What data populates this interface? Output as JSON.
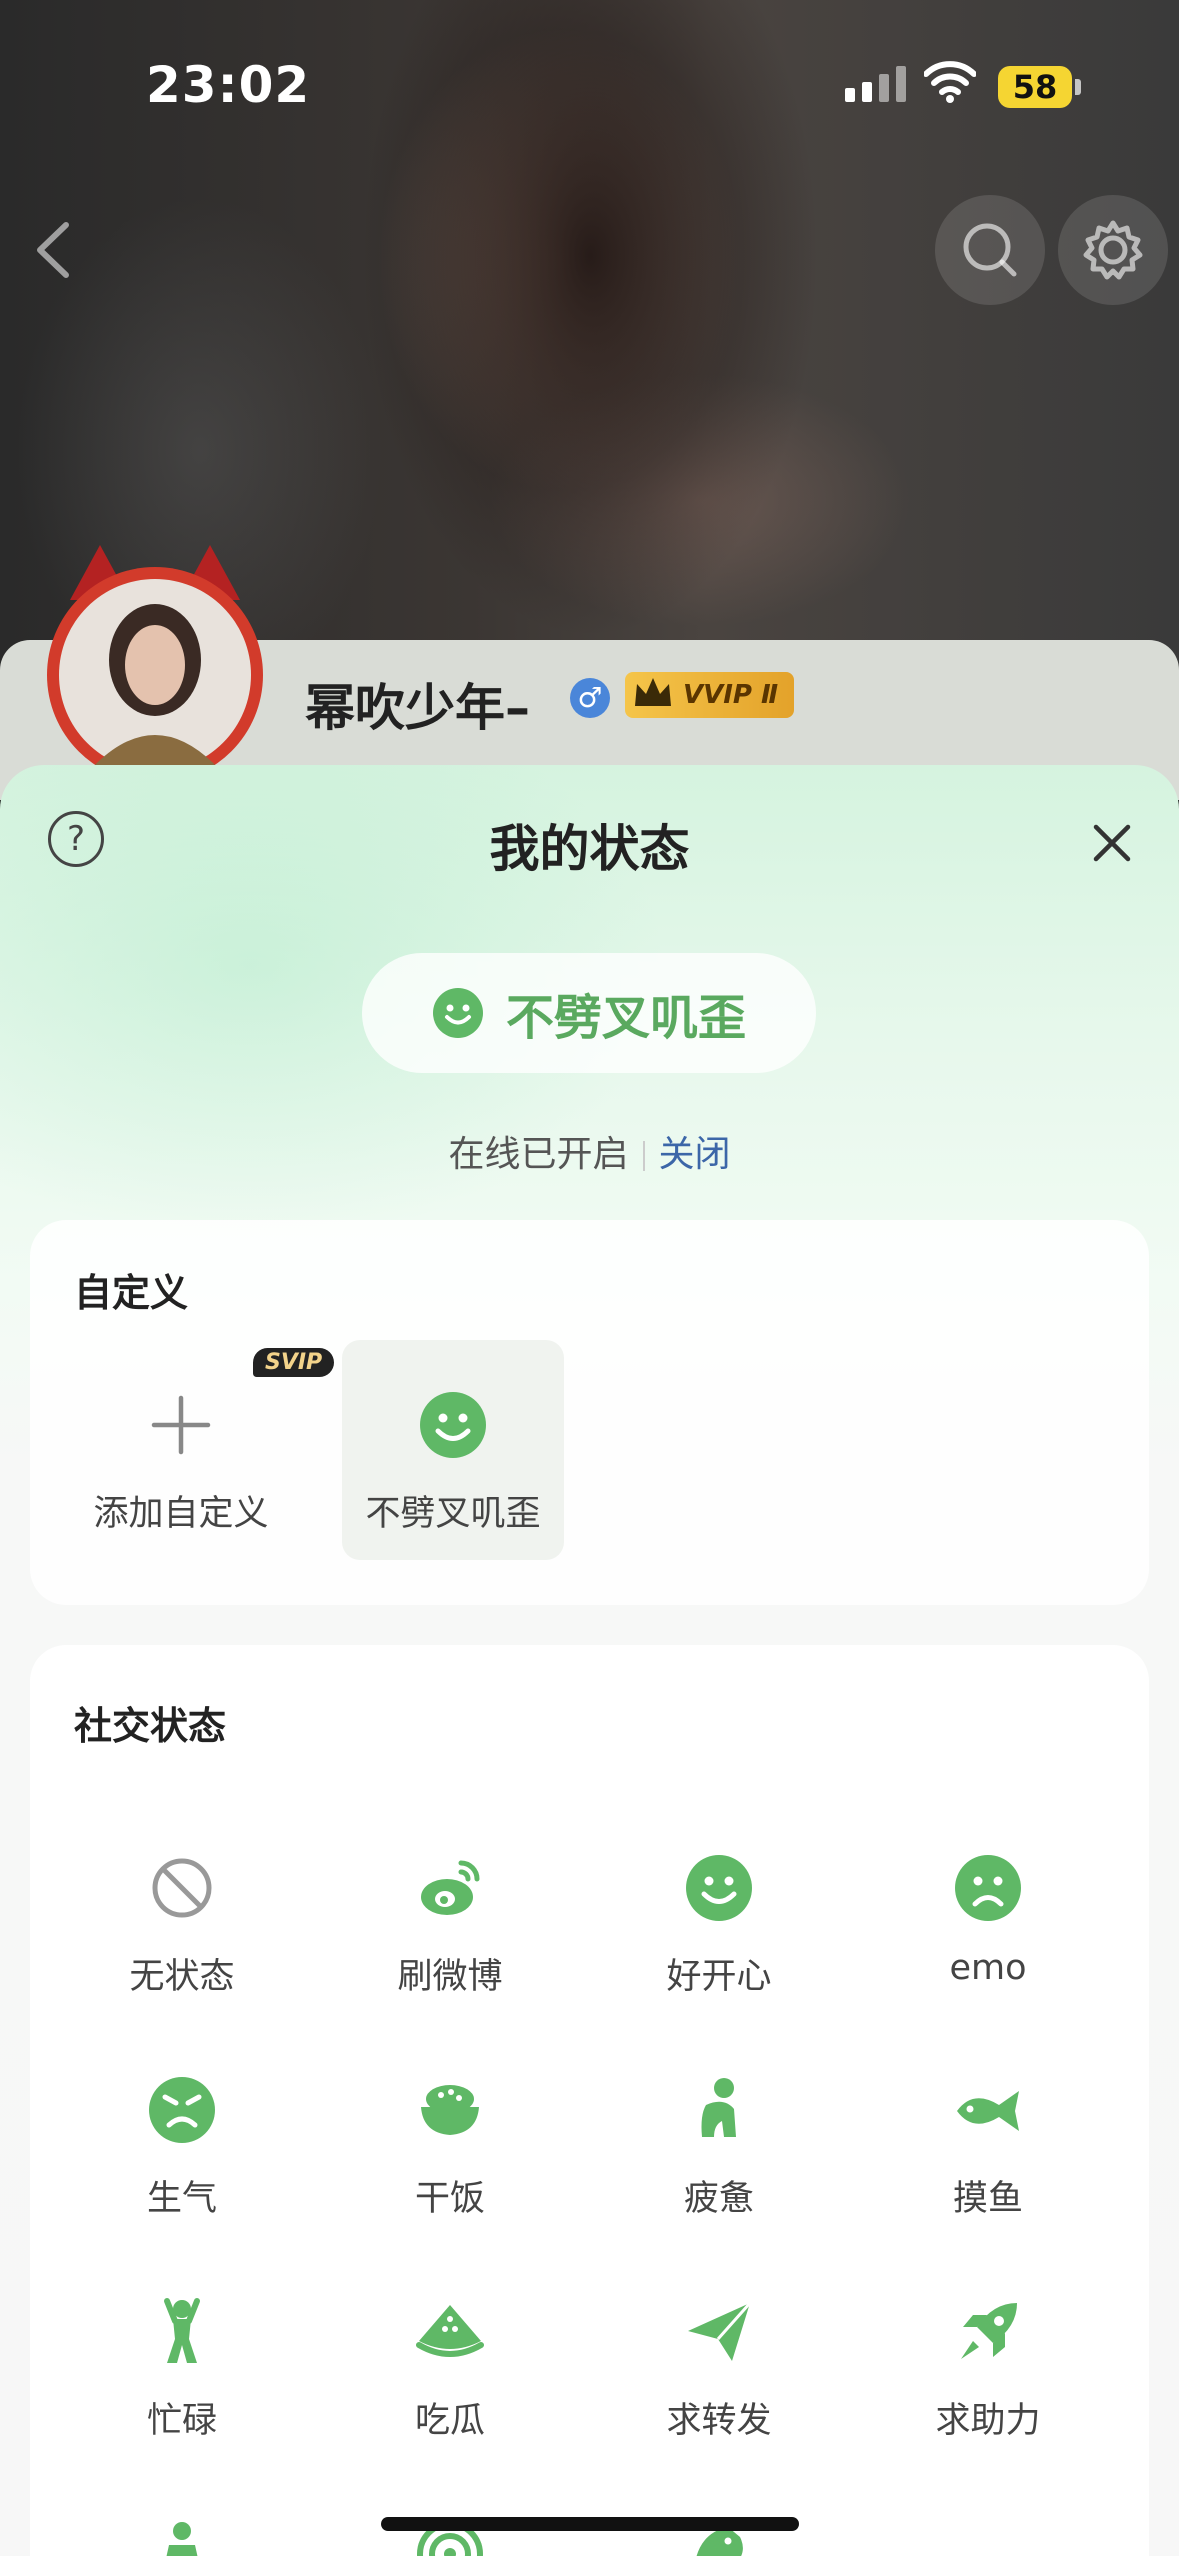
{
  "status_bar": {
    "time": "23:02",
    "battery": "58"
  },
  "profile": {
    "username": "幂吹少年–",
    "gender_symbol": "♂",
    "vip_badge": "VVIP Ⅱ"
  },
  "sheet": {
    "title": "我的状态",
    "help_symbol": "?",
    "current_status": "不劈叉叽歪",
    "online_text": "在线已开启",
    "close_toggle": "关闭"
  },
  "custom_section": {
    "title": "自定义",
    "add_label": "添加自定义",
    "svip_badge": "SVIP",
    "selected_label": "不劈叉叽歪"
  },
  "social_section": {
    "title": "社交状态",
    "items": [
      {
        "label": "无状态",
        "icon": "no-status-icon"
      },
      {
        "label": "刷微博",
        "icon": "weibo-icon"
      },
      {
        "label": "好开心",
        "icon": "smile-icon"
      },
      {
        "label": "emo",
        "icon": "sad-face-icon"
      },
      {
        "label": "生气",
        "icon": "angry-face-icon"
      },
      {
        "label": "干饭",
        "icon": "rice-bowl-icon"
      },
      {
        "label": "疲惫",
        "icon": "tired-person-icon"
      },
      {
        "label": "摸鱼",
        "icon": "fish-icon"
      },
      {
        "label": "忙碌",
        "icon": "busy-person-icon"
      },
      {
        "label": "吃瓜",
        "icon": "watermelon-icon"
      },
      {
        "label": "求转发",
        "icon": "paper-plane-icon"
      },
      {
        "label": "求助力",
        "icon": "rocket-icon"
      }
    ]
  },
  "colors": {
    "accent_green": "#5fb866",
    "link_blue": "#3c66a8"
  }
}
